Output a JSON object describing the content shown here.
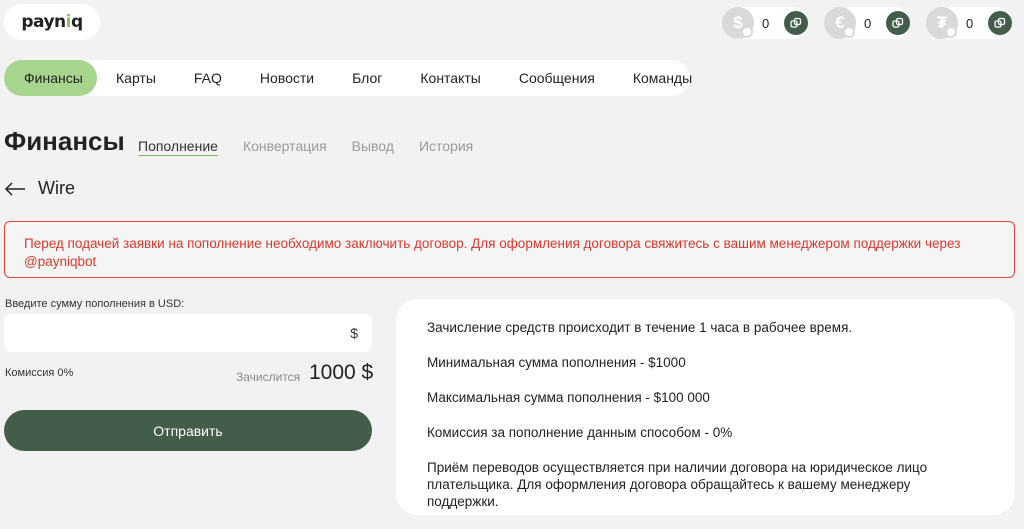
{
  "logo": {
    "text_a": "payn",
    "text_b": "i",
    "text_c": "q"
  },
  "balances": [
    {
      "symbol": "$",
      "amount": "0"
    },
    {
      "symbol": "€",
      "amount": "0"
    },
    {
      "symbol": "₮",
      "amount": "0"
    }
  ],
  "nav": {
    "items": [
      "Финансы",
      "Карты",
      "FAQ",
      "Новости",
      "Блог",
      "Контакты",
      "Сообщения",
      "Команды"
    ],
    "active": "Финансы"
  },
  "page": {
    "title": "Финансы",
    "subtabs": [
      "Пополнение",
      "Конвертация",
      "Вывод",
      "История"
    ],
    "active_subtab": "Пополнение"
  },
  "back": {
    "label": "Wire"
  },
  "alert": {
    "text": "Перед подачей заявки на пополнение необходимо заключить договор. Для оформления договора свяжитесь с вашим менеджером поддержки через @payniqbot"
  },
  "form": {
    "amount_label": "Введите сумму пополнения в USD:",
    "amount_value": "",
    "amount_currency": "$",
    "commission": "Комиссия 0%",
    "credit_label": "Зачислится",
    "credit_value": "1000 $",
    "submit_label": "Отправить"
  },
  "info": {
    "lines": [
      "Зачисление средств происходит в течение 1 часа в рабочее время.",
      "Минимальная сумма пополнения - $1000",
      "Максимальная сумма пополнения - $100 000",
      "Комиссия за пополнение данным способом - 0%",
      "Приём переводов осуществляется при наличии договора на юридическое лицо плательщика. Для оформления договора обращайтесь к вашему менеджеру поддержки."
    ]
  },
  "colors": {
    "accent": "#a8d58e",
    "dark_green": "#445d4b",
    "alert_red": "#d83a30"
  },
  "icons": {
    "back": "arrow-left-icon",
    "exchange": "exchange-icon"
  }
}
